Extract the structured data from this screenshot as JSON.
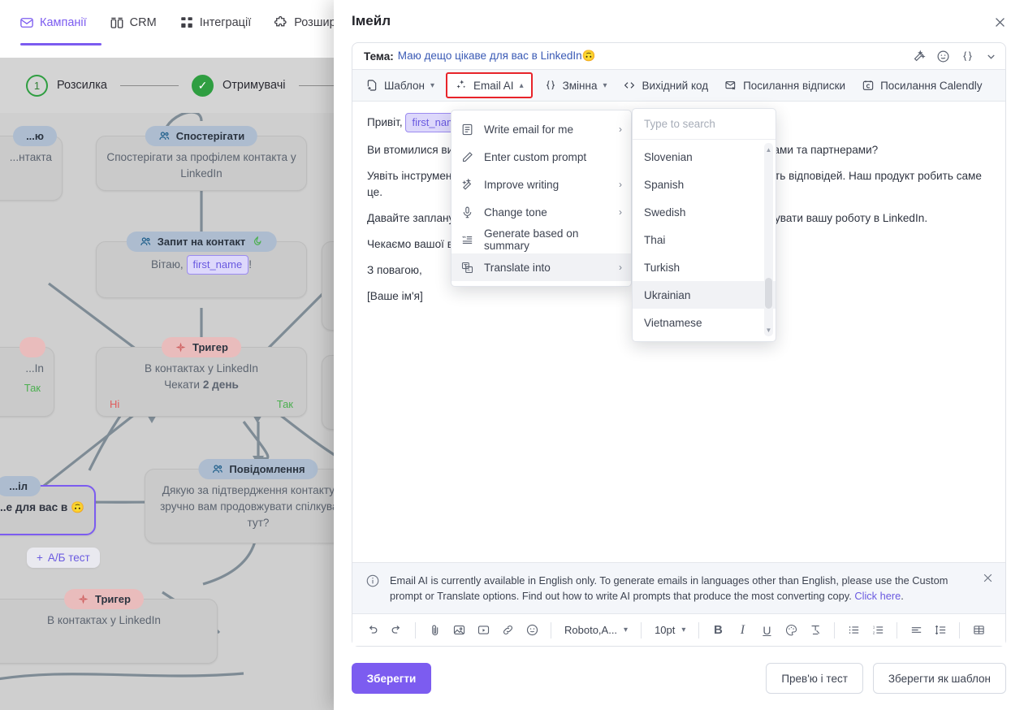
{
  "background": {
    "nav": {
      "items": [
        {
          "label": "Кампанії",
          "icon": "envelope-icon",
          "active": true
        },
        {
          "label": "CRM",
          "icon": "crm-icon",
          "active": false
        },
        {
          "label": "Інтеграції",
          "icon": "grid-icon",
          "active": false
        },
        {
          "label": "Розширення",
          "icon": "puzzle-icon",
          "active": false
        }
      ]
    },
    "steps": [
      {
        "number": "1",
        "label": "Розсилка",
        "state": "current"
      },
      {
        "number": "✓",
        "label": "Отримувачі",
        "state": "done"
      }
    ],
    "nodes": [
      {
        "chip": "Спостерігати",
        "chip_icon": "people-icon",
        "type": "action",
        "text": "Спостерігати за профілем контакта у LinkedIn"
      },
      {
        "chip": "Запит на контакт",
        "chip_icon": "people-icon",
        "type": "action",
        "badge": "flame-icon",
        "text_prefix": "Вітаю,",
        "variable": "first_name",
        "text_suffix": "!"
      },
      {
        "chip": "Тригер",
        "chip_icon": "star-icon",
        "type": "trigger",
        "line1": "В контактах у LinkedIn",
        "line2_prefix": "Чекати",
        "line2_bold": "2 день",
        "no_label": "Ні",
        "yes_label": "Так"
      },
      {
        "chip": "Повідомлення",
        "chip_icon": "people-icon",
        "type": "action",
        "text": "Дякую за підтвердження контакту! Чи зручно вам продовжувати спілкування тут?"
      },
      {
        "chip": "Тригер",
        "chip_icon": "star-icon",
        "type": "trigger",
        "line1": "В контактах у LinkedIn"
      }
    ],
    "left_partial_nodes": [
      {
        "chip": "...ю",
        "text": "...нтакта"
      },
      {
        "chip": "",
        "line1": "...In",
        "yes_label": "Так"
      },
      {
        "chip": "...іл",
        "text": "...е для вас в 🙃",
        "selected": true
      }
    ],
    "ab_test_label": "А/Б тест"
  },
  "modal": {
    "title": "Імейл",
    "close_icon": "close-icon",
    "subject": {
      "label": "Тема:",
      "value": "Маю дещо цікаве для вас в LinkedIn🙃",
      "icons": [
        "magic-wand-icon",
        "emoji-icon",
        "variable-braces-icon",
        "chevron-down-icon"
      ]
    },
    "toolbar": [
      {
        "label": "Шаблон",
        "icon": "template-icon",
        "chevron": "▾",
        "highlighted": false
      },
      {
        "label": "Email AI",
        "icon": "sparkle-icon",
        "chevron": "▴",
        "highlighted": true
      },
      {
        "label": "Змінна",
        "icon": "braces-icon",
        "chevron": "▾",
        "highlighted": false
      },
      {
        "label": "Вихідний код",
        "icon": "code-icon",
        "chevron": "",
        "highlighted": false
      },
      {
        "label": "Посилання відписки",
        "icon": "unsubscribe-icon",
        "chevron": "",
        "highlighted": false
      },
      {
        "label": "Посилання Calendly",
        "icon": "calendar-icon",
        "chevron": "",
        "highlighted": false
      }
    ],
    "body": {
      "greeting_prefix": "Привіт,",
      "greeting_variable": "first_name",
      "paragraphs": [
        "Ви втомилися витрачати години на пошук та спілкування з потенційними клієнтами та партнерами?",
        "Уявіть інструмент, який автоматизує вашу роботу в LinkedIn, збільшуючи кількість відповідей. Наш продукт  робить саме це.",
        "Давайте заплануємо коротку зустріч, щоб обговорити, як це може революціонізувати вашу роботу в LinkedIn.",
        "Чекаємо вашої відповіді!",
        "З повагою,",
        "[Ваше ім'я]"
      ]
    },
    "notice": {
      "icon": "info-icon",
      "text_part1": "Email AI is currently available in English only. To generate emails in languages other than English, please use the Custom prompt or Translate options. Find out how to write AI prompts that produce the most converting copy. ",
      "link": "Click here",
      "text_part2": ".",
      "close_icon": "close-icon"
    },
    "format_toolbar": {
      "icons_left": [
        "undo-icon",
        "redo-icon",
        "attachment-icon",
        "image-icon",
        "video-icon",
        "link-icon",
        "emoji-icon"
      ],
      "font_family": "Roboto,A...",
      "font_size": "10pt",
      "icons_right": [
        "bold-icon",
        "italic-icon",
        "underline-icon",
        "text-color-icon",
        "clear-format-icon",
        "bullet-list-icon",
        "numbered-list-icon",
        "align-icon",
        "line-height-icon",
        "table-icon"
      ]
    },
    "footer": {
      "save": "Зберегти",
      "preview_test": "Прев'ю і тест",
      "save_as_template": "Зберегти як шаблон"
    }
  },
  "ai_menu": {
    "items": [
      {
        "label": "Write email for me",
        "icon": "document-icon",
        "arrow": "›",
        "active": false
      },
      {
        "label": "Enter custom prompt",
        "icon": "pencil-icon",
        "arrow": "",
        "active": false
      },
      {
        "label": "Improve writing",
        "icon": "magic-wand-icon",
        "arrow": "›",
        "active": false
      },
      {
        "label": "Change tone",
        "icon": "microphone-icon",
        "arrow": "›",
        "active": false
      },
      {
        "label": "Generate based on summary",
        "icon": "quote-icon",
        "arrow": "",
        "active": false
      },
      {
        "label": "Translate into",
        "icon": "translate-icon",
        "arrow": "›",
        "active": true
      }
    ]
  },
  "language_menu": {
    "search_placeholder": "Type to search",
    "search_value": "",
    "items": [
      {
        "label": "Slovenian",
        "selected": false
      },
      {
        "label": "Spanish",
        "selected": false
      },
      {
        "label": "Swedish",
        "selected": false
      },
      {
        "label": "Thai",
        "selected": false
      },
      {
        "label": "Turkish",
        "selected": false
      },
      {
        "label": "Ukrainian",
        "selected": true
      },
      {
        "label": "Vietnamese",
        "selected": false
      }
    ],
    "scroll_up_arrow": "▲",
    "scroll_down_arrow": "▼"
  },
  "colors": {
    "accent": "#7c5cf0",
    "highlight_border": "#e8242a",
    "link": "#6a5ae0",
    "success": "#2f9e41",
    "danger": "#e05b5b"
  }
}
